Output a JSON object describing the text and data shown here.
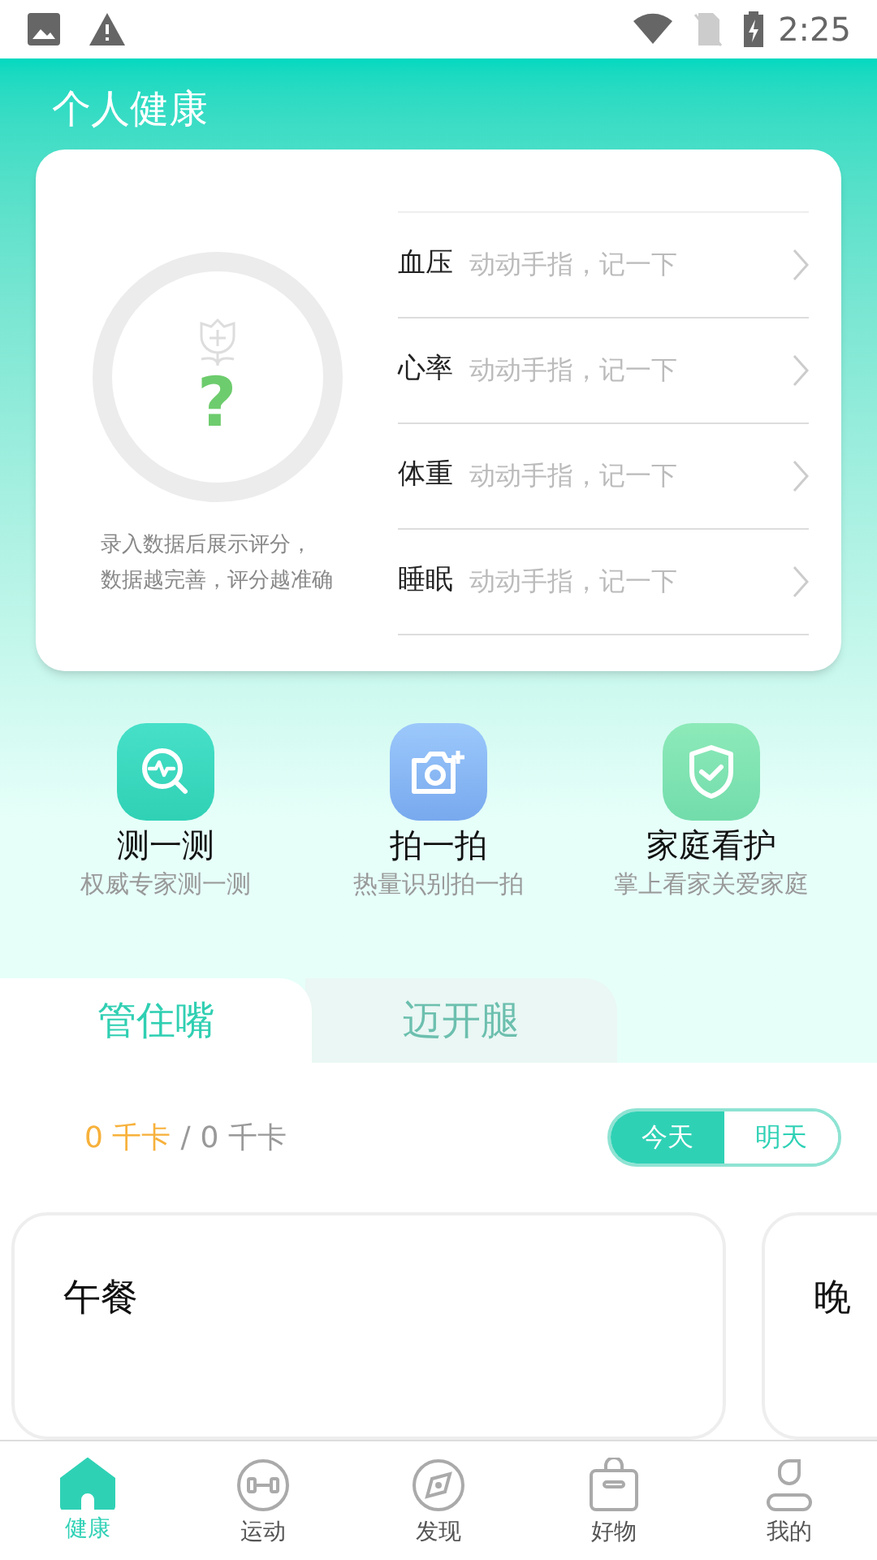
{
  "status_bar": {
    "time": "2:25"
  },
  "header": {
    "title": "个人健康"
  },
  "score_card": {
    "score": "?",
    "hint_lines": [
      "录入数据后展示评分，",
      "数据越完善，评分越准确"
    ],
    "metrics": [
      {
        "label": "血压",
        "hint": "动动手指，记一下"
      },
      {
        "label": "心率",
        "hint": "动动手指，记一下"
      },
      {
        "label": "体重",
        "hint": "动动手指，记一下"
      },
      {
        "label": "睡眠",
        "hint": "动动手指，记一下"
      }
    ]
  },
  "actions": [
    {
      "kind": "measure",
      "title": "测一测",
      "subtitle": "权威专家测一测"
    },
    {
      "kind": "photo",
      "title": "拍一拍",
      "subtitle": "热量识别拍一拍"
    },
    {
      "kind": "family",
      "title": "家庭看护",
      "subtitle": "掌上看家关爱家庭"
    }
  ],
  "tabs": [
    {
      "label": "管住嘴",
      "selected": true
    },
    {
      "label": "迈开腿",
      "selected": false
    }
  ],
  "calories": {
    "eaten": "0 千卡",
    "separator": "/",
    "target": "0 千卡"
  },
  "day_toggle": [
    {
      "label": "今天",
      "selected": true
    },
    {
      "label": "明天",
      "selected": false
    }
  ],
  "meals": [
    {
      "title": "午餐"
    },
    {
      "title": "晚"
    }
  ],
  "nav": [
    {
      "kind": "home",
      "label": "健康",
      "selected": true
    },
    {
      "kind": "sport",
      "label": "运动",
      "selected": false
    },
    {
      "kind": "discover",
      "label": "发现",
      "selected": false
    },
    {
      "kind": "shop",
      "label": "好物",
      "selected": false
    },
    {
      "kind": "me",
      "label": "我的",
      "selected": false
    }
  ]
}
